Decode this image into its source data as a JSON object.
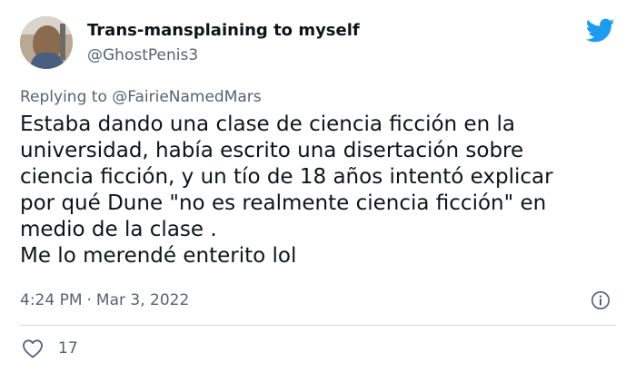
{
  "author": {
    "display_name": "Trans-mansplaining to myself",
    "handle": "@GhostPenis3"
  },
  "reply": {
    "prefix": "Replying to",
    "mention": "@FairieNamedMars"
  },
  "tweet": {
    "lines": [
      "Estaba dando una clase de ciencia ficción en la",
      "universidad, había escrito una disertación sobre",
      "ciencia ficción, y un tío de 18 años intentó explicar",
      "por qué Dune \"no es realmente ciencia ficción\" en",
      "medio de la clase .",
      "Me lo merendé enterito lol"
    ]
  },
  "meta": {
    "time": "4:24 PM",
    "separator": "·",
    "date": "Mar 3, 2022"
  },
  "engagement": {
    "likes": "17"
  },
  "colors": {
    "twitter_blue": "#1d9bf0",
    "text": "#0f1419",
    "secondary": "#536471",
    "divider": "#cfd9de"
  },
  "icons": {
    "logo": "twitter-bird-icon",
    "info": "info-icon",
    "like": "heart-icon"
  }
}
